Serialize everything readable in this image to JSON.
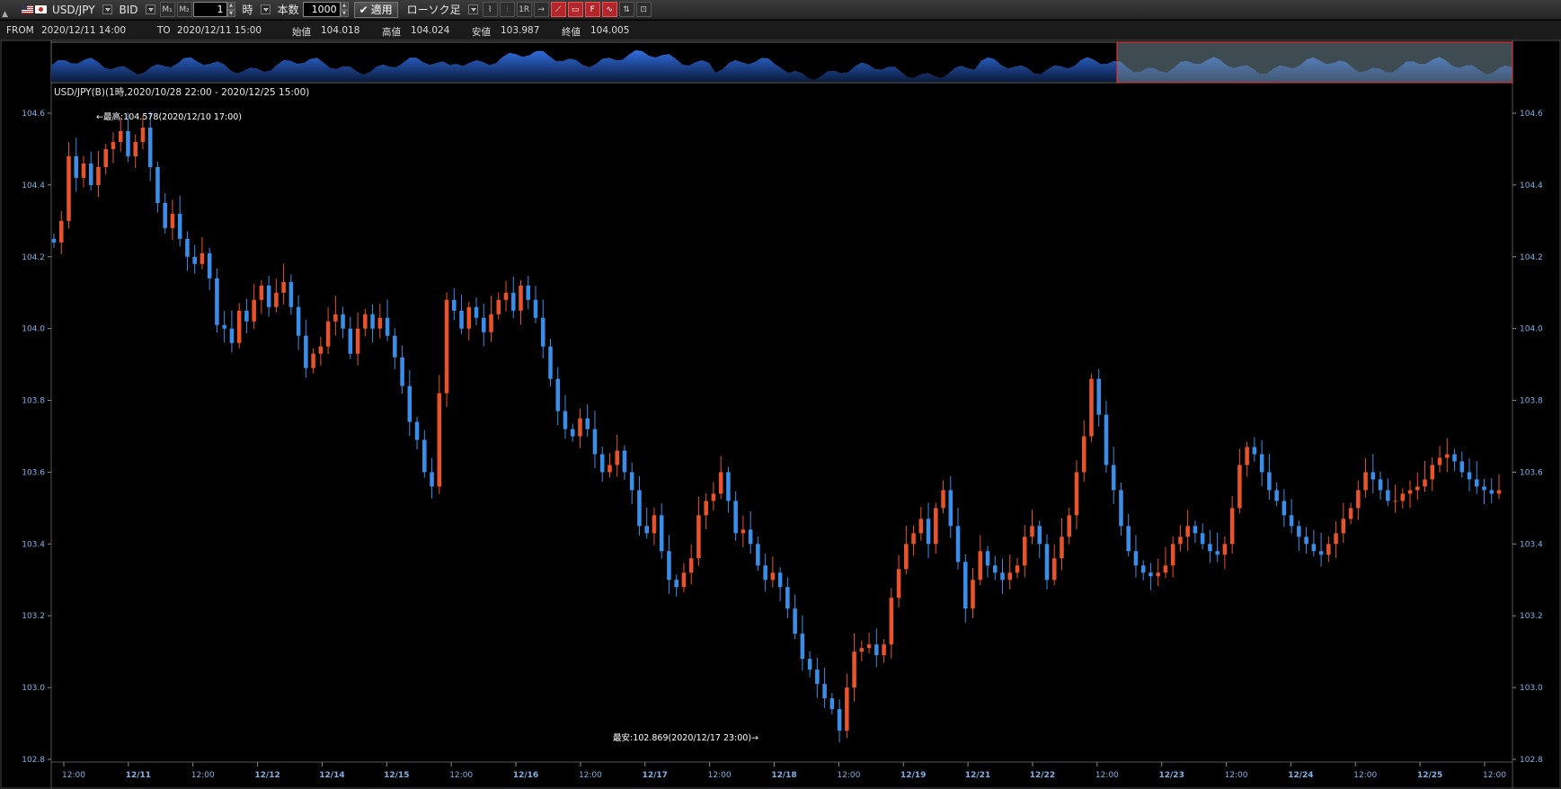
{
  "toolbar": {
    "symbol": "USD/JPY",
    "price_side": "BID",
    "period_value": "1",
    "period_unit": "時",
    "count_label": "本数",
    "count_value": "1000",
    "apply_label": "適用",
    "chart_style": "ローソク足",
    "icons": [
      "interval-m1-icon",
      "interval-m2-icon",
      "line-chart-icon",
      "bar-chart-icon",
      "renko-icon",
      "scroll-right-icon",
      "red-tool-1-icon",
      "red-tool-2-icon",
      "red-tool-3-icon",
      "red-tool-4-icon",
      "tool-5-icon",
      "tool-6-icon"
    ]
  },
  "info": {
    "from_label": "FROM",
    "from_value": "2020/12/11 14:00",
    "to_label": "TO",
    "to_value": "2020/12/11 15:00",
    "open_label": "始値",
    "open_value": "104.018",
    "high_label": "高値",
    "high_value": "104.024",
    "low_label": "安値",
    "low_value": "103.987",
    "close_label": "終値",
    "close_value": "104.005"
  },
  "chart_data": {
    "type": "candlestick",
    "title": "USD/JPY(B)(1時,2020/10/28 22:00 - 2020/12/25 15:00)",
    "ylim": [
      102.8,
      104.6
    ],
    "yticks": [
      "104.6",
      "104.4",
      "104.2",
      "104.0",
      "103.8",
      "103.6",
      "103.4",
      "103.2",
      "103.0",
      "102.8"
    ],
    "xticks": [
      {
        "label": "12:00",
        "bold": false
      },
      {
        "label": "12/11",
        "bold": true
      },
      {
        "label": "12:00",
        "bold": false
      },
      {
        "label": "12/12",
        "bold": true
      },
      {
        "label": "12/14",
        "bold": true
      },
      {
        "label": "12/15",
        "bold": true
      },
      {
        "label": "12:00",
        "bold": false
      },
      {
        "label": "12/16",
        "bold": true
      },
      {
        "label": "12:00",
        "bold": false
      },
      {
        "label": "12/17",
        "bold": true
      },
      {
        "label": "12:00",
        "bold": false
      },
      {
        "label": "12/18",
        "bold": true
      },
      {
        "label": "12:00",
        "bold": false
      },
      {
        "label": "12/19",
        "bold": true
      },
      {
        "label": "12/21",
        "bold": true
      },
      {
        "label": "12/22",
        "bold": true
      },
      {
        "label": "12:00",
        "bold": false
      },
      {
        "label": "12/23",
        "bold": true
      },
      {
        "label": "12:00",
        "bold": false
      },
      {
        "label": "12/24",
        "bold": true
      },
      {
        "label": "12:00",
        "bold": false
      },
      {
        "label": "12/25",
        "bold": true
      },
      {
        "label": "12:00",
        "bold": false
      }
    ],
    "max_annotation": "←最高:104.578(2020/12/10 17:00)",
    "min_annotation": "最安:102.869(2020/12/17 23:00)→",
    "max_value": 104.578,
    "min_value": 102.869,
    "colors": {
      "up": "#e8532b",
      "down": "#3b8ee8",
      "axis_text": "#7fb2e6",
      "navigator": "#2f6ee0"
    },
    "closes": [
      104.24,
      104.3,
      104.48,
      104.42,
      104.46,
      104.4,
      104.45,
      104.5,
      104.52,
      104.55,
      104.48,
      104.52,
      104.56,
      104.45,
      104.35,
      104.28,
      104.32,
      104.25,
      104.2,
      104.18,
      104.21,
      104.14,
      104.01,
      104.0,
      103.96,
      104.05,
      104.02,
      104.08,
      104.12,
      104.06,
      104.1,
      104.13,
      104.06,
      103.98,
      103.89,
      103.93,
      103.95,
      104.02,
      104.04,
      104.0,
      103.93,
      104.0,
      104.04,
      104.0,
      104.03,
      103.98,
      103.92,
      103.84,
      103.74,
      103.69,
      103.6,
      103.56,
      103.82,
      104.08,
      104.05,
      104.0,
      104.06,
      104.03,
      103.99,
      104.04,
      104.08,
      104.1,
      104.05,
      104.12,
      104.08,
      104.03,
      103.95,
      103.86,
      103.77,
      103.72,
      103.7,
      103.75,
      103.72,
      103.65,
      103.6,
      103.62,
      103.66,
      103.6,
      103.55,
      103.45,
      103.43,
      103.48,
      103.38,
      103.3,
      103.28,
      103.32,
      103.36,
      103.48,
      103.52,
      103.54,
      103.6,
      103.52,
      103.43,
      103.44,
      103.4,
      103.34,
      103.3,
      103.32,
      103.28,
      103.22,
      103.15,
      103.08,
      103.05,
      103.01,
      102.97,
      102.94,
      102.88,
      103.0,
      103.1,
      103.11,
      103.12,
      103.09,
      103.12,
      103.25,
      103.33,
      103.4,
      103.43,
      103.47,
      103.4,
      103.5,
      103.55,
      103.45,
      103.35,
      103.22,
      103.3,
      103.38,
      103.34,
      103.32,
      103.3,
      103.32,
      103.34,
      103.42,
      103.45,
      103.4,
      103.3,
      103.36,
      103.42,
      103.48,
      103.6,
      103.7,
      103.86,
      103.76,
      103.62,
      103.55,
      103.45,
      103.38,
      103.34,
      103.32,
      103.31,
      103.32,
      103.34,
      103.4,
      103.42,
      103.45,
      103.43,
      103.4,
      103.38,
      103.37,
      103.4,
      103.5,
      103.62,
      103.67,
      103.65,
      103.6,
      103.55,
      103.52,
      103.48,
      103.45,
      103.42,
      103.4,
      103.38,
      103.37,
      103.4,
      103.43,
      103.47,
      103.5,
      103.55,
      103.6,
      103.58,
      103.55,
      103.52,
      103.52,
      103.54,
      103.55,
      103.56,
      103.58,
      103.62,
      103.64,
      103.65,
      103.63,
      103.6,
      103.58,
      103.56,
      103.55,
      103.54,
      103.55
    ],
    "x_pixel_note": ""
  },
  "navigator": {
    "handle_label": ""
  }
}
